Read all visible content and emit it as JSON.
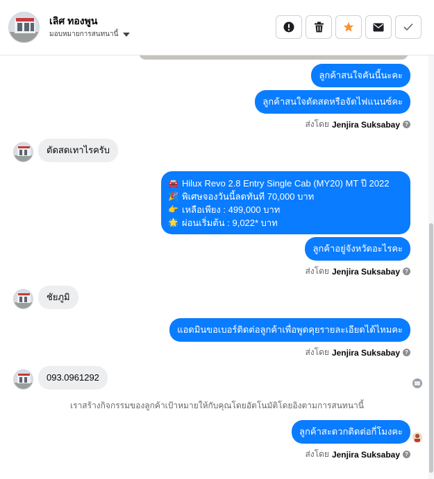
{
  "header": {
    "contact_name": "เลิศ ทองพูน",
    "subtitle": "มอบหมายการสนทนานี้"
  },
  "actions": [
    {
      "name": "report-button",
      "icon": "alert-icon"
    },
    {
      "name": "delete-button",
      "icon": "trash-icon"
    },
    {
      "name": "star-button",
      "icon": "star-icon",
      "color": "#f7923a"
    },
    {
      "name": "mail-button",
      "icon": "envelope-icon"
    },
    {
      "name": "done-button",
      "icon": "check-icon"
    }
  ],
  "messages": {
    "m1": "ลูกค้าสนใจคันนี้นะคะ",
    "m2": "ลูกค้าสนใจตัดสดหรือจัดไฟแนนซ์คะ",
    "m3": "ตัดสดเทาไรครับ",
    "promo": {
      "line1": "Hilux Revo 2.8 Entry Single Cab (MY20) MT ปี 2022",
      "line2": "พิเศษจองวันนี้ลดทันที 70,000 บาท",
      "line3": "เหลือเพียง : 499,000 บาท",
      "line4": "ผ่อนเริ่มต้น : 9,022* บาท"
    },
    "m5": "ลูกค้าอยู่จังหวัดอะไรคะ",
    "m6": "ชัยภูมิ",
    "m7": "แอดมินขอเบอร์ติดต่อลูกค้าเพื่อพูดคุยรายละเอียดได้ไหมคะ",
    "m8": "093.0961292",
    "m9": "ลูกค้าสะดวกติดต่อกี่โมงคะ"
  },
  "sent_by": {
    "prefix": "ส่งโดย",
    "agent": "Jenjira Suksabay"
  },
  "system_note": "เราสร้างกิจกรรมของลูกค้าเป้าหมายให้กับคุณโดยอัตโนมัติโดยอิงตามการสนทนานี้",
  "colors": {
    "outgoing": "#0a7cff",
    "incoming": "#eceef0",
    "star": "#f7923a"
  }
}
